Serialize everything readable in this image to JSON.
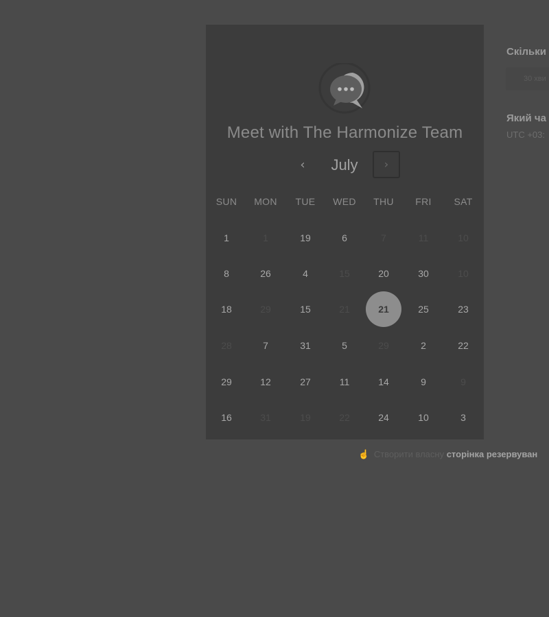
{
  "booking": {
    "title": "Meet with The Harmonize Team",
    "month": "July",
    "prev_icon": "chevron-left-icon",
    "next_icon": "chevron-right-icon",
    "prev_glyph": "‹",
    "next_glyph": "›",
    "weekdays": [
      "SUN",
      "MON",
      "TUE",
      "WED",
      "THU",
      "FRI",
      "SAT"
    ],
    "weeks": [
      [
        {
          "d": "1",
          "dim": false
        },
        {
          "d": "1",
          "dim": true
        },
        {
          "d": "19",
          "dim": false
        },
        {
          "d": "6",
          "dim": false
        },
        {
          "d": "7",
          "dim": true
        },
        {
          "d": "11",
          "dim": true
        },
        {
          "d": "10",
          "dim": true
        }
      ],
      [
        {
          "d": "8",
          "dim": false
        },
        {
          "d": "26",
          "dim": false
        },
        {
          "d": "4",
          "dim": false
        },
        {
          "d": "15",
          "dim": true
        },
        {
          "d": "20",
          "dim": false
        },
        {
          "d": "30",
          "dim": false
        },
        {
          "d": "10",
          "dim": true
        }
      ],
      [
        {
          "d": "18",
          "dim": false
        },
        {
          "d": "29",
          "dim": true
        },
        {
          "d": "15",
          "dim": false
        },
        {
          "d": "21",
          "dim": true
        },
        {
          "d": "21",
          "dim": false,
          "selected": true
        },
        {
          "d": "25",
          "dim": false
        },
        {
          "d": "23",
          "dim": false
        }
      ],
      [
        {
          "d": "28",
          "dim": true
        },
        {
          "d": "7",
          "dim": false
        },
        {
          "d": "31",
          "dim": false
        },
        {
          "d": "5",
          "dim": false
        },
        {
          "d": "29",
          "dim": true
        },
        {
          "d": "2",
          "dim": false
        },
        {
          "d": "22",
          "dim": false
        }
      ],
      [
        {
          "d": "29",
          "dim": false
        },
        {
          "d": "12",
          "dim": false
        },
        {
          "d": "27",
          "dim": false
        },
        {
          "d": "11",
          "dim": false
        },
        {
          "d": "14",
          "dim": false
        },
        {
          "d": "9",
          "dim": false
        },
        {
          "d": "9",
          "dim": true
        }
      ],
      [
        {
          "d": "16",
          "dim": false
        },
        {
          "d": "31",
          "dim": true
        },
        {
          "d": "19",
          "dim": true
        },
        {
          "d": "22",
          "dim": true
        },
        {
          "d": "24",
          "dim": false
        },
        {
          "d": "10",
          "dim": false
        },
        {
          "d": "3",
          "dim": false
        }
      ]
    ]
  },
  "right_panel": {
    "duration_label": "Скільки",
    "duration_value": "30 хви",
    "time_label": "Який ча",
    "timezone": "UTC +03:"
  },
  "footer": {
    "icon": "pointer-hand-icon",
    "icon_glyph": "☝",
    "plain_text": "Створити власну",
    "link_text": "сторінка резервуван"
  },
  "colors": {
    "page_background": "#4a4a4a",
    "card_background": "#3c3c3c",
    "selected_day": "#8d8d8d"
  }
}
